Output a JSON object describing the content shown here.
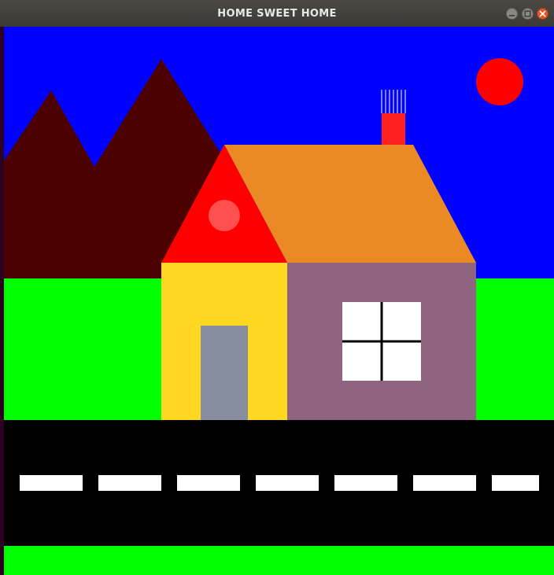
{
  "window": {
    "title": "HOME SWEET HOME"
  },
  "colors": {
    "sky": "#0000ff",
    "sun": "#ff0000",
    "mountains": "#4d0000",
    "grass": "#00ff00",
    "road": "#000000",
    "road_markings": "#ffffff",
    "roof_front": "#ff0000",
    "roof_window": "#ff5050",
    "roof_side": "#eb8a25",
    "chimney": "#ff2020",
    "smoke": "#ffffff",
    "house_front": "#ffd721",
    "door": "#868ea0",
    "house_side": "#8e6480",
    "window": "#ffffff",
    "window_frame": "#000000"
  },
  "icons": {
    "minimize": "minimize-icon",
    "maximize": "maximize-icon",
    "close": "close-icon"
  }
}
